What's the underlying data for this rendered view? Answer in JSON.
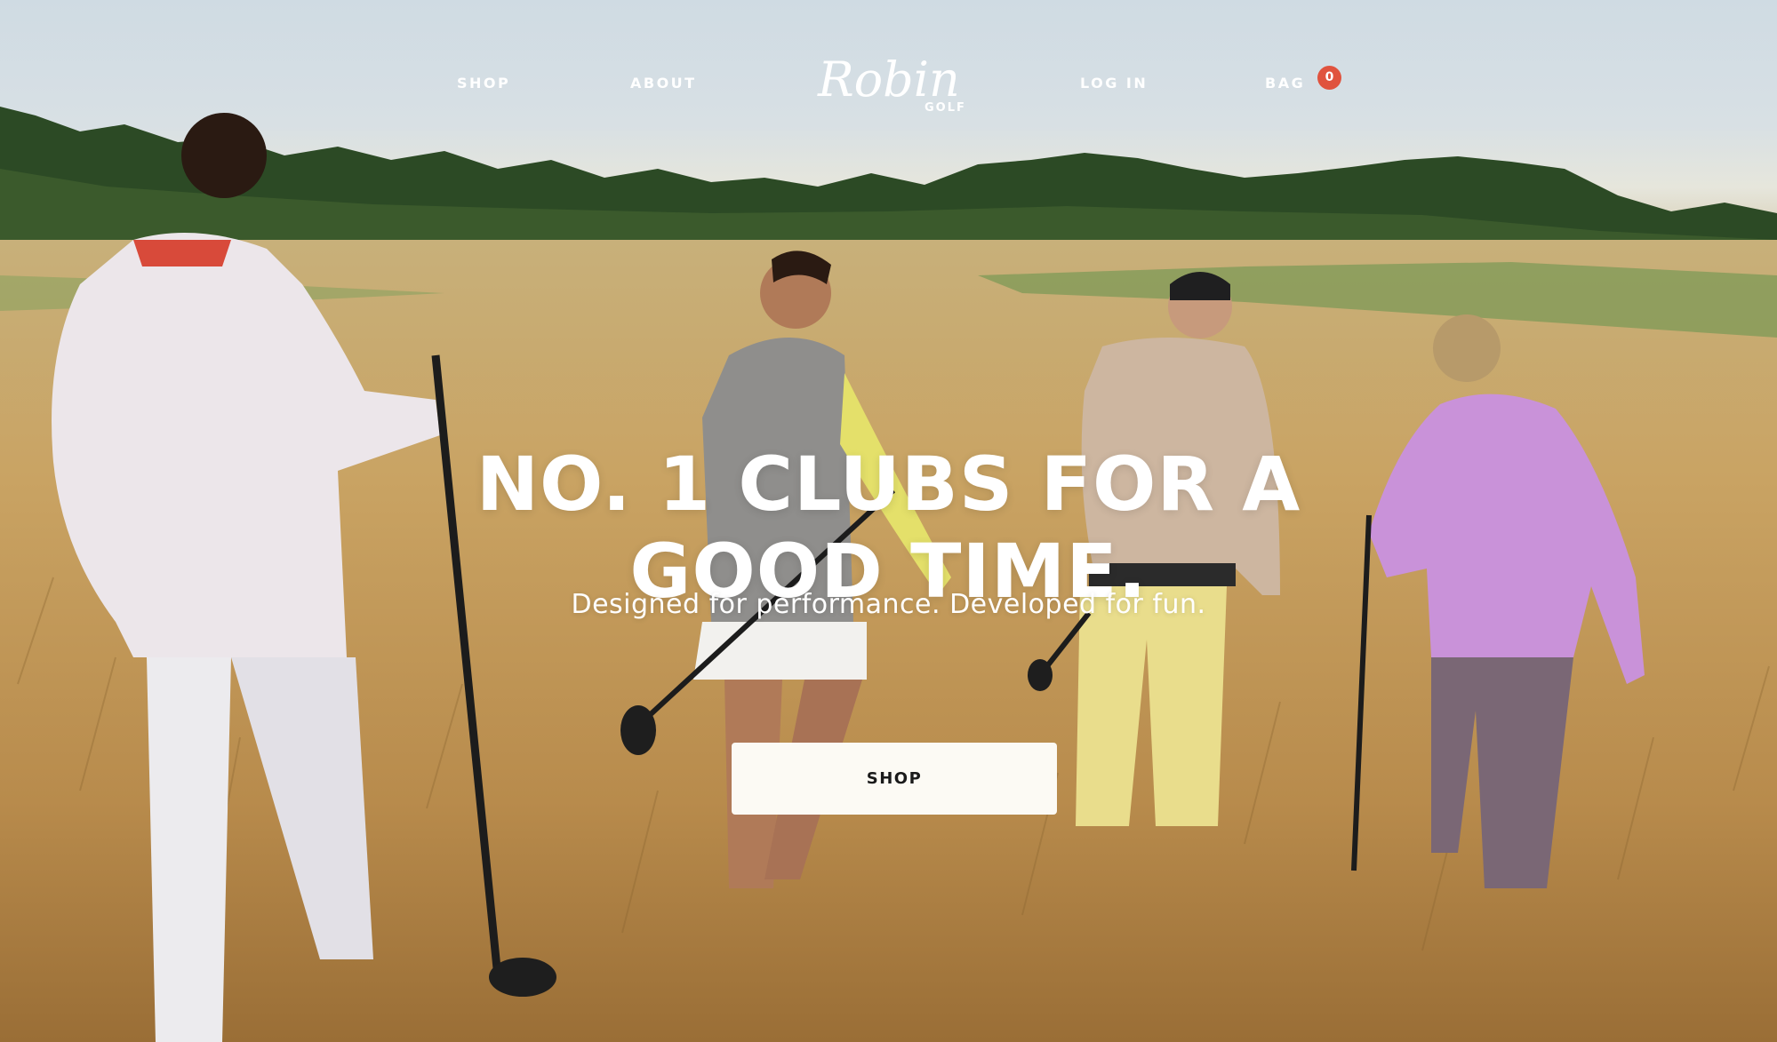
{
  "nav": {
    "shop_label": "SHOP",
    "about_label": "ABOUT",
    "login_label": "LOG IN",
    "bag_label": "BAG",
    "bag_count": "0"
  },
  "logo": {
    "script_text": "Robin",
    "sub_text": "GOLF"
  },
  "hero": {
    "headline_line1": "NO. 1 CLUBS FOR A",
    "headline_line2": "GOOD TIME.",
    "subheadline": "Designed for performance. Developed for fun.",
    "cta_label": "SHOP"
  },
  "colors": {
    "badge": "#e0533e",
    "button_bg": "#fcfaf4",
    "text_light": "#ffffff",
    "text_dark": "#1a1a1a"
  }
}
